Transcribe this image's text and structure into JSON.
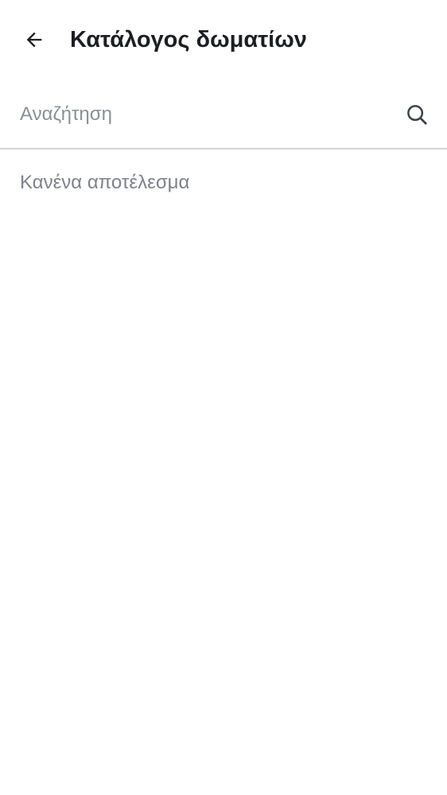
{
  "header": {
    "title": "Κατάλογος δωματίων",
    "back_icon": "arrow-left-icon"
  },
  "search": {
    "placeholder": "Αναζήτηση",
    "value": "",
    "icon": "search-icon"
  },
  "results": {
    "empty_message": "Κανένα αποτέλεσμα"
  },
  "colors": {
    "title_text": "#1c1e22",
    "muted_text": "#7d828a",
    "divider": "#d2d4d8",
    "background": "#ffffff"
  }
}
